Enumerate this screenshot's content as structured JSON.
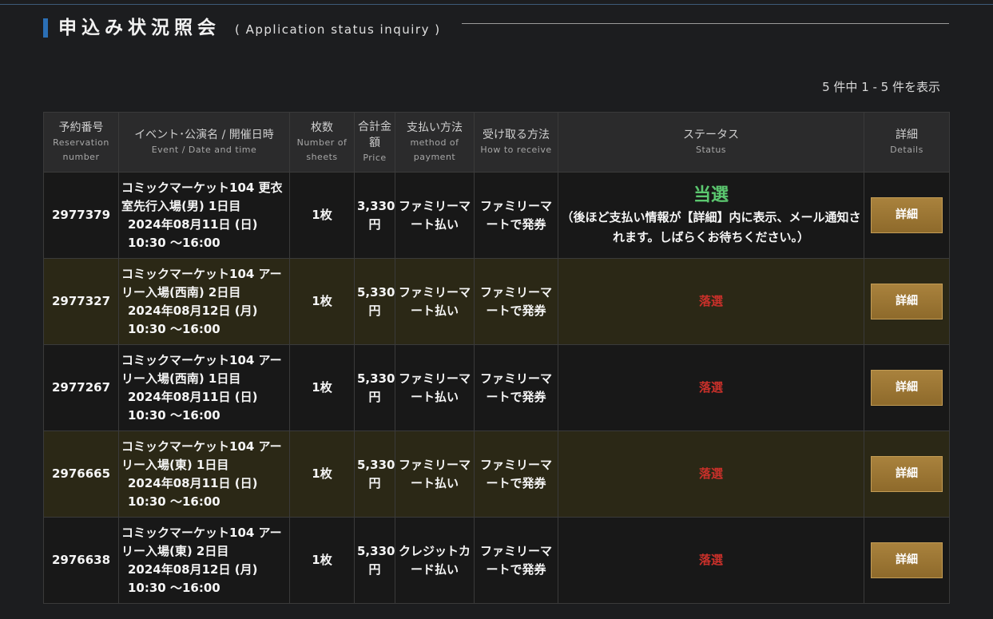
{
  "header": {
    "title_jp": "申込み状況照会",
    "title_en": "( Application status inquiry )"
  },
  "result_count": "5 件中 1 - 5 件を表示",
  "columns": [
    {
      "jp": "予約番号",
      "en": "Reservation number"
    },
    {
      "jp": "イベント･公演名 / 開催日時",
      "en": "Event / Date and time"
    },
    {
      "jp": "枚数",
      "en": "Number of sheets"
    },
    {
      "jp": "合計金額",
      "en": "Price"
    },
    {
      "jp": "支払い方法",
      "en": "method of payment"
    },
    {
      "jp": "受け取る方法",
      "en": "How to receive"
    },
    {
      "jp": "ステータス",
      "en": "Status"
    },
    {
      "jp": "詳細",
      "en": "Details"
    }
  ],
  "rows": [
    {
      "reservation_number": "2977379",
      "event_name": "コミックマーケット104 更衣室先行入場(男) 1日目",
      "event_datetime": "2024年08月11日 (日) 10:30 ～16:00",
      "sheets": "1枚",
      "price": "3,330円",
      "payment": "ファミリーマート払い",
      "receive": "ファミリーマートで発券",
      "status": "当選",
      "status_note": "（後ほど支払い情報が【詳細】内に表示、メール通知されます。しばらくお待ちください。）",
      "details_label": "詳細"
    },
    {
      "reservation_number": "2977327",
      "event_name": "コミックマーケット104 アーリー入場(西南) 2日目",
      "event_datetime": "2024年08月12日 (月) 10:30 ～16:00",
      "sheets": "1枚",
      "price": "5,330円",
      "payment": "ファミリーマート払い",
      "receive": "ファミリーマートで発券",
      "status": "落選",
      "details_label": "詳細"
    },
    {
      "reservation_number": "2977267",
      "event_name": "コミックマーケット104 アーリー入場(西南) 1日目",
      "event_datetime": "2024年08月11日 (日) 10:30 ～16:00",
      "sheets": "1枚",
      "price": "5,330円",
      "payment": "ファミリーマート払い",
      "receive": "ファミリーマートで発券",
      "status": "落選",
      "details_label": "詳細"
    },
    {
      "reservation_number": "2976665",
      "event_name": "コミックマーケット104 アーリー入場(東) 1日目",
      "event_datetime": "2024年08月11日 (日) 10:30 ～16:00",
      "sheets": "1枚",
      "price": "5,330円",
      "payment": "ファミリーマート払い",
      "receive": "ファミリーマートで発券",
      "status": "落選",
      "details_label": "詳細"
    },
    {
      "reservation_number": "2976638",
      "event_name": "コミックマーケット104 アーリー入場(東) 2日目",
      "event_datetime": "2024年08月12日 (月) 10:30 ～16:00",
      "sheets": "1枚",
      "price": "5,330円",
      "payment": "クレジットカード払い",
      "receive": "ファミリーマートで発券",
      "status": "落選",
      "details_label": "詳細"
    }
  ],
  "colors": {
    "accent_bar": "#2b6fb5",
    "status_win": "#5bc76f",
    "status_lose": "#c8302a",
    "button": "#9a7533"
  }
}
